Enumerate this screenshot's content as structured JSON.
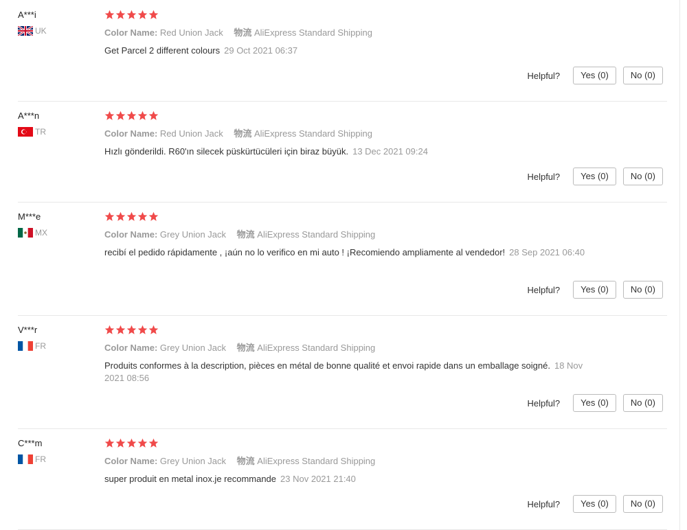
{
  "labels": {
    "color_name": "Color Name:",
    "logistics": "物流",
    "helpful": "Helpful?"
  },
  "colors": {
    "star": "#f04a4a",
    "muted": "#999999",
    "border": "#e8e8e8"
  },
  "reviews": [
    {
      "user": "A***i",
      "country": "UK",
      "flag": "uk",
      "rating": 5,
      "color": "Red Union Jack",
      "shipping": "AliExpress Standard Shipping",
      "text": "Get Parcel 2 different colours",
      "date": "29 Oct 2021 06:37",
      "yes": "Yes (0)",
      "no": "No (0)"
    },
    {
      "user": "A***n",
      "country": "TR",
      "flag": "tr",
      "rating": 5,
      "color": "Red Union Jack",
      "shipping": "AliExpress Standard Shipping",
      "text": "Hızlı gönderildi. R60'ın silecek püskürtücüleri için biraz büyük.",
      "date": "13 Dec 2021 09:24",
      "yes": "Yes (0)",
      "no": "No (0)"
    },
    {
      "user": "M***e",
      "country": "MX",
      "flag": "mx",
      "rating": 5,
      "color": "Grey Union Jack",
      "shipping": "AliExpress Standard Shipping",
      "text": "recibí el pedido rápidamente , ¡aún no lo verifico en mi auto ! ¡Recomiendo ampliamente al vendedor!",
      "date": "28 Sep 2021 06:40",
      "yes": "Yes (0)",
      "no": "No (0)"
    },
    {
      "user": "V***r",
      "country": "FR",
      "flag": "fr",
      "rating": 5,
      "color": "Grey Union Jack",
      "shipping": "AliExpress Standard Shipping",
      "text": "Produits conformes à la description, pièces en métal de bonne qualité et envoi rapide dans un emballage soigné.",
      "date": "18 Nov 2021 08:56",
      "yes": "Yes (0)",
      "no": "No (0)"
    },
    {
      "user": "C***m",
      "country": "FR",
      "flag": "fr",
      "rating": 5,
      "color": "Grey Union Jack",
      "shipping": "AliExpress Standard Shipping",
      "text": "super produit en metal inox.je recommande",
      "date": "23 Nov 2021 21:40",
      "yes": "Yes (0)",
      "no": "No (0)"
    }
  ]
}
